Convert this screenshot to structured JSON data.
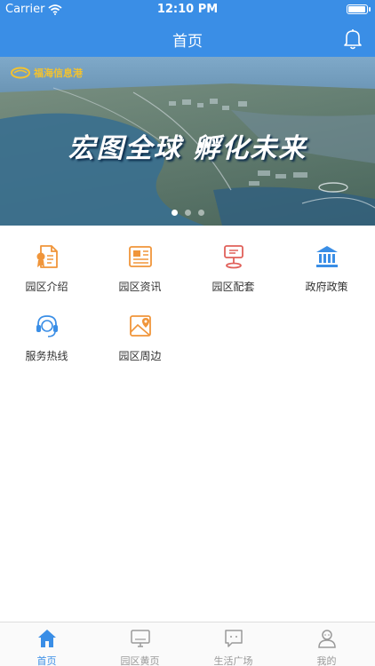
{
  "status_bar": {
    "carrier": "Carrier",
    "time": "12:10 PM",
    "battery_level": 1.0
  },
  "nav": {
    "title": "首页",
    "notification_icon": "bell-icon"
  },
  "banner": {
    "logo_text": "福海信息港",
    "slogan": "宏图全球 孵化未来",
    "slides_count": 3,
    "active_slide": 1
  },
  "grid": {
    "items": [
      {
        "label": "园区介绍",
        "icon": "certificate-icon",
        "color": "#f0953a"
      },
      {
        "label": "园区资讯",
        "icon": "newspaper-icon",
        "color": "#f0953a"
      },
      {
        "label": "园区配套",
        "icon": "sign-icon",
        "color": "#e0605a"
      },
      {
        "label": "政府政策",
        "icon": "government-icon",
        "color": "#3a8ee6"
      },
      {
        "label": "服务热线",
        "icon": "headset-icon",
        "color": "#3a8ee6"
      },
      {
        "label": "园区周边",
        "icon": "map-icon",
        "color": "#f0953a"
      }
    ]
  },
  "tabbar": {
    "items": [
      {
        "label": "首页",
        "icon": "home-icon",
        "active": true
      },
      {
        "label": "园区黄页",
        "icon": "monitor-icon",
        "active": false
      },
      {
        "label": "生活广场",
        "icon": "chat-icon",
        "active": false
      },
      {
        "label": "我的",
        "icon": "user-icon",
        "active": false
      }
    ]
  },
  "colors": {
    "primary": "#3a8ee6",
    "accent_orange": "#f0953a",
    "accent_red": "#e0605a",
    "inactive": "#999999"
  }
}
